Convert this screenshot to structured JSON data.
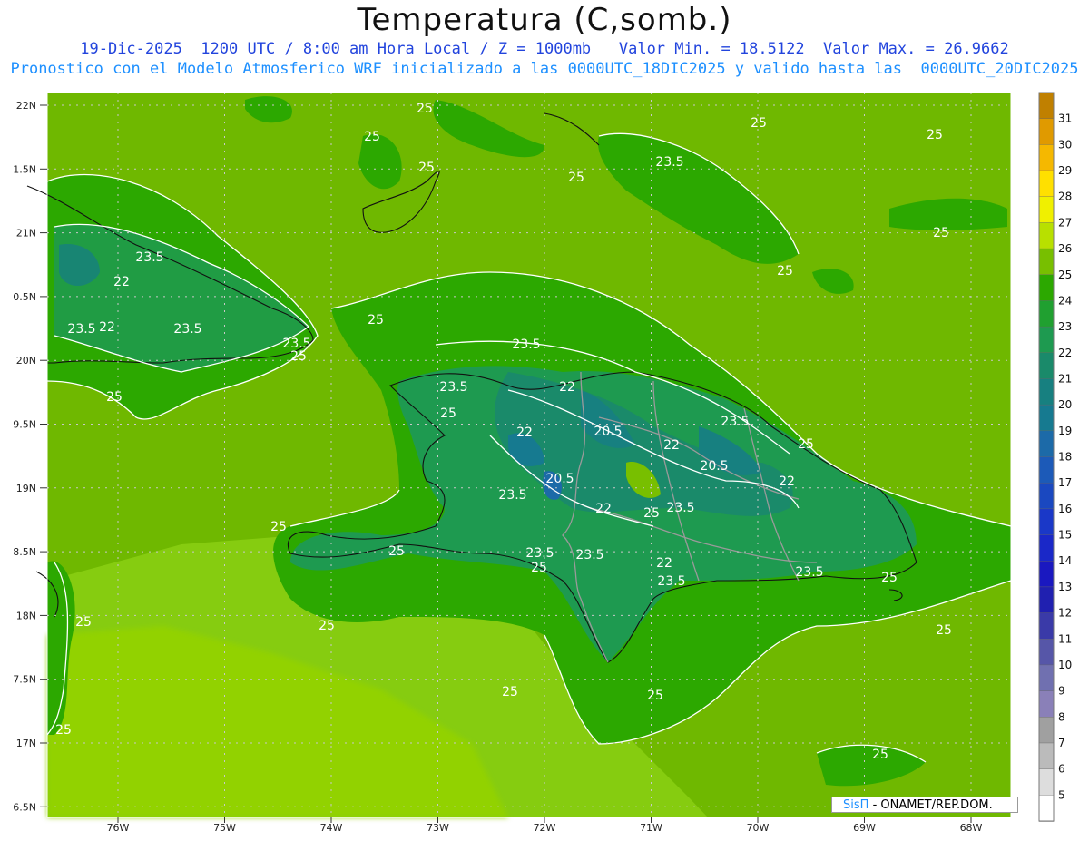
{
  "header": {
    "title": "Temperatura (C,somb.)",
    "subtitle_line1": "19-Dic-2025  1200 UTC / 8:00 am Hora Local / Z = 1000mb   Valor Min. = 18.5122  Valor Max. = 26.9662",
    "subtitle_line2": "Pronostico con el Modelo Atmosferico WRF inicializado a las 0000UTC_18DIC2025 y valido hasta las  0000UTC_20DIC2025"
  },
  "axes": {
    "lat_labels": [
      "22N",
      "1.5N",
      "21N",
      "0.5N",
      "20N",
      "9.5N",
      "19N",
      "8.5N",
      "18N",
      "7.5N",
      "17N",
      "6.5N"
    ],
    "lon_labels": [
      "76W",
      "75W",
      "74W",
      "73W",
      "72W",
      "71W",
      "70W",
      "69W",
      "68W"
    ]
  },
  "contour_labels": [
    "25",
    "23.5",
    "22",
    "20.5"
  ],
  "colorbar": {
    "labels": [
      "31",
      "30",
      "29",
      "28",
      "27",
      "26",
      "25",
      "24",
      "23",
      "22",
      "21",
      "20",
      "19",
      "18",
      "17",
      "16",
      "15",
      "14",
      "13",
      "12",
      "11",
      "10",
      "9",
      "8",
      "7",
      "6",
      "5"
    ],
    "colors": [
      "#c08000",
      "#e09a00",
      "#f5b800",
      "#ffe000",
      "#f0f000",
      "#b8e000",
      "#78bf00",
      "#2ca800",
      "#20a030",
      "#1e9a50",
      "#1a8a6a",
      "#178080",
      "#167a90",
      "#1c6aa8",
      "#1c5ab8",
      "#1a48c0",
      "#1a38c8",
      "#1a28c8",
      "#1a18c0",
      "#2020b0",
      "#3a3aa8",
      "#5656a8",
      "#7070b0",
      "#8a80b8",
      "#a0a0a0",
      "#bbbbbb",
      "#dddddd",
      "#ffffff"
    ]
  },
  "credit": {
    "brand": "SisΠ",
    "text": "- ONAMET/REP.DOM."
  }
}
